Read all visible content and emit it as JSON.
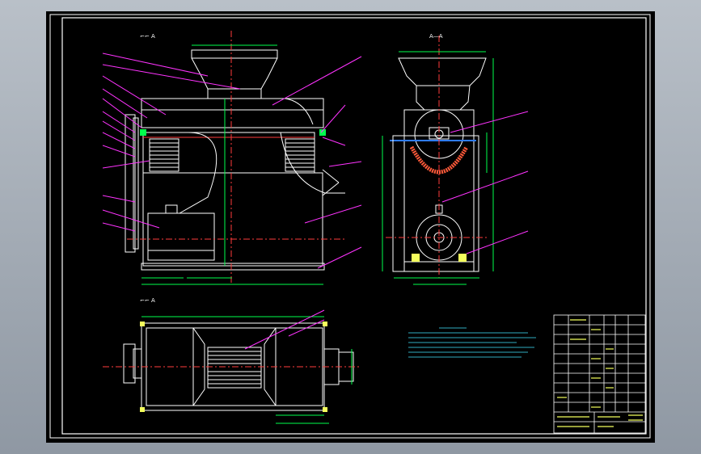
{
  "view_labels": {
    "front": "⌐⌐  A",
    "section": "A—A",
    "top": "⌐⌐  A"
  },
  "colors": {
    "background": "#000000",
    "outline": "#ffffff",
    "centerline": "#ff3b3b",
    "dimension": "#00ff4c",
    "leader": "#ff33ff",
    "notes": "#3fe6ff",
    "title_block": "#f4ff5c",
    "highlight": "#2f7cff"
  }
}
